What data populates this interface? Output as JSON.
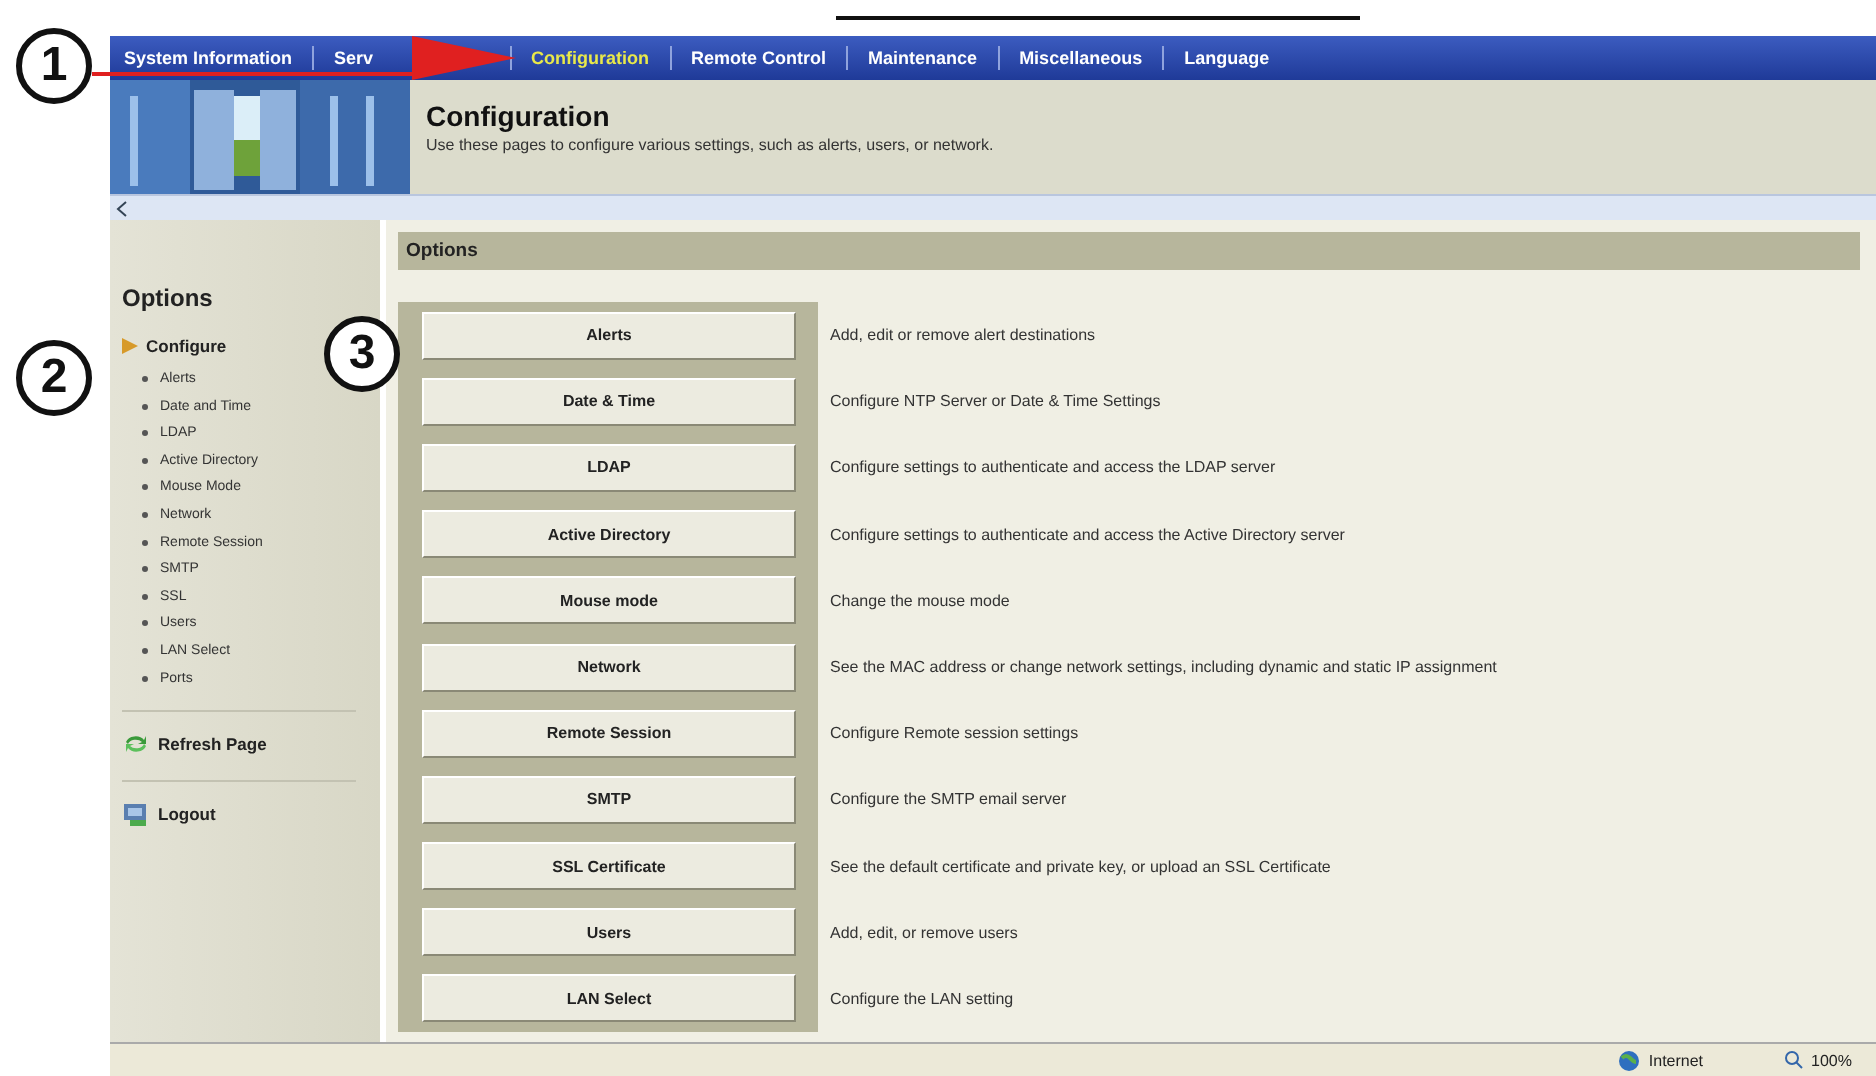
{
  "nav": [
    {
      "label": "System Information",
      "selected": false
    },
    {
      "label": "Serv",
      "selected": false
    },
    {
      "label": "Configuration",
      "selected": true
    },
    {
      "label": "Remote Control",
      "selected": false
    },
    {
      "label": "Maintenance",
      "selected": false
    },
    {
      "label": "Miscellaneous",
      "selected": false
    },
    {
      "label": "Language",
      "selected": false
    }
  ],
  "header": {
    "title": "Configuration",
    "subtitle": "Use these pages to configure various settings, such as alerts, users, or network."
  },
  "sidebar": {
    "title": "Options",
    "section": {
      "label": "Configure",
      "expanded": true,
      "children": [
        {
          "label": "Alerts"
        },
        {
          "label": "Date and Time"
        },
        {
          "label": "LDAP"
        },
        {
          "label": "Active Directory"
        },
        {
          "label": "Mouse Mode"
        },
        {
          "label": "Network"
        },
        {
          "label": "Remote Session"
        },
        {
          "label": "SMTP"
        },
        {
          "label": "SSL"
        },
        {
          "label": "Users"
        },
        {
          "label": "LAN Select"
        },
        {
          "label": "Ports"
        }
      ]
    },
    "actions": [
      {
        "label": "Refresh Page",
        "kind": "refresh"
      },
      {
        "label": "Logout",
        "kind": "logout"
      }
    ]
  },
  "options": {
    "title": "Options",
    "rows": [
      {
        "button": "Alerts",
        "description": "Add, edit or remove alert destinations"
      },
      {
        "button": "Date & Time",
        "description": "Configure NTP Server or Date & Time Settings"
      },
      {
        "button": "LDAP",
        "description": "Configure settings to authenticate and access the LDAP server"
      },
      {
        "button": "Active Directory",
        "description": "Configure settings to authenticate and access the Active Directory server"
      },
      {
        "button": "Mouse mode",
        "description": "Change the mouse mode"
      },
      {
        "button": "Network",
        "description": "See the MAC address or change network settings, including dynamic and static IP assignment"
      },
      {
        "button": "Remote Session",
        "description": "Configure Remote session settings"
      },
      {
        "button": "SMTP",
        "description": "Configure the SMTP email server"
      },
      {
        "button": "SSL Certificate",
        "description": "See the default certificate and private key, or upload an SSL Certificate"
      },
      {
        "button": "Users",
        "description": "Add, edit, or remove users"
      },
      {
        "button": "LAN Select",
        "description": "Configure the LAN setting"
      }
    ]
  },
  "status_bar": {
    "zone": "Internet",
    "zoom": "100%"
  },
  "callouts": [
    "1",
    "2",
    "3"
  ]
}
